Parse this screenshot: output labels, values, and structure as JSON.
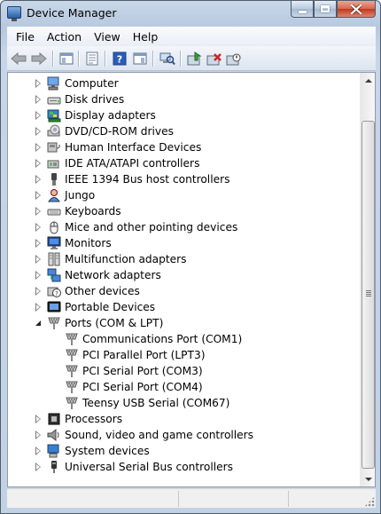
{
  "window": {
    "title": "Device Manager"
  },
  "menu": [
    "File",
    "Action",
    "View",
    "Help"
  ],
  "toolbar": [
    "back-icon",
    "forward-icon",
    "show-hide-tree-icon",
    "properties-icon",
    "help-icon",
    "console-tree-icon",
    "scan-hardware-icon",
    "update-driver-icon",
    "uninstall-icon",
    "disable-device-icon"
  ],
  "tree": [
    {
      "label": "Computer",
      "icon": "computer-icon",
      "level": 0,
      "state": "collapsed"
    },
    {
      "label": "Disk drives",
      "icon": "disk-drive-icon",
      "level": 0,
      "state": "collapsed"
    },
    {
      "label": "Display adapters",
      "icon": "display-adapter-icon",
      "level": 0,
      "state": "collapsed"
    },
    {
      "label": "DVD/CD-ROM drives",
      "icon": "dvd-drive-icon",
      "level": 0,
      "state": "collapsed"
    },
    {
      "label": "Human Interface Devices",
      "icon": "hid-icon",
      "level": 0,
      "state": "collapsed"
    },
    {
      "label": "IDE ATA/ATAPI controllers",
      "icon": "ide-controller-icon",
      "level": 0,
      "state": "collapsed"
    },
    {
      "label": "IEEE 1394 Bus host controllers",
      "icon": "firewire-icon",
      "level": 0,
      "state": "collapsed"
    },
    {
      "label": "Jungo",
      "icon": "jungo-icon",
      "level": 0,
      "state": "collapsed"
    },
    {
      "label": "Keyboards",
      "icon": "keyboard-icon",
      "level": 0,
      "state": "collapsed"
    },
    {
      "label": "Mice and other pointing devices",
      "icon": "mouse-icon",
      "level": 0,
      "state": "collapsed"
    },
    {
      "label": "Monitors",
      "icon": "monitor-icon",
      "level": 0,
      "state": "collapsed"
    },
    {
      "label": "Multifunction adapters",
      "icon": "multifunction-icon",
      "level": 0,
      "state": "collapsed"
    },
    {
      "label": "Network adapters",
      "icon": "network-adapter-icon",
      "level": 0,
      "state": "collapsed"
    },
    {
      "label": "Other devices",
      "icon": "other-devices-icon",
      "level": 0,
      "state": "collapsed"
    },
    {
      "label": "Portable Devices",
      "icon": "portable-device-icon",
      "level": 0,
      "state": "collapsed"
    },
    {
      "label": "Ports (COM & LPT)",
      "icon": "port-icon",
      "level": 0,
      "state": "expanded"
    },
    {
      "label": "Communications Port (COM1)",
      "icon": "port-icon",
      "level": 1,
      "state": "leaf"
    },
    {
      "label": "PCI Parallel Port (LPT3)",
      "icon": "port-icon",
      "level": 1,
      "state": "leaf"
    },
    {
      "label": "PCI Serial Port (COM3)",
      "icon": "port-icon",
      "level": 1,
      "state": "leaf"
    },
    {
      "label": "PCI Serial Port (COM4)",
      "icon": "port-icon",
      "level": 1,
      "state": "leaf"
    },
    {
      "label": "Teensy USB Serial (COM67)",
      "icon": "port-icon",
      "level": 1,
      "state": "leaf"
    },
    {
      "label": "Processors",
      "icon": "processor-icon",
      "level": 0,
      "state": "collapsed"
    },
    {
      "label": "Sound, video and game controllers",
      "icon": "sound-icon",
      "level": 0,
      "state": "collapsed"
    },
    {
      "label": "System devices",
      "icon": "system-device-icon",
      "level": 0,
      "state": "collapsed"
    },
    {
      "label": "Universal Serial Bus controllers",
      "icon": "usb-icon",
      "level": 0,
      "state": "collapsed"
    }
  ]
}
